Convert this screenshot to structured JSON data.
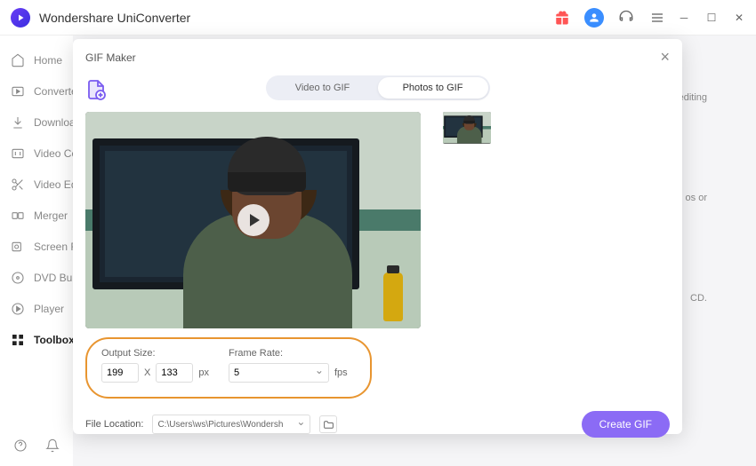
{
  "app": {
    "title": "Wondershare UniConverter"
  },
  "sidebar": {
    "items": [
      {
        "label": "Home"
      },
      {
        "label": "Converter"
      },
      {
        "label": "Downloader"
      },
      {
        "label": "Video Compressor"
      },
      {
        "label": "Video Editor"
      },
      {
        "label": "Merger"
      },
      {
        "label": "Screen Recorder"
      },
      {
        "label": "DVD Burner"
      },
      {
        "label": "Player"
      },
      {
        "label": "Toolbox"
      }
    ]
  },
  "modal": {
    "title": "GIF Maker",
    "tabs": {
      "video": "Video to GIF",
      "photos": "Photos to GIF"
    },
    "settings": {
      "output_size_label": "Output Size:",
      "width": "199",
      "times": "X",
      "height": "133",
      "unit": "px",
      "frame_rate_label": "Frame Rate:",
      "fps_value": "5",
      "fps_unit": "fps"
    },
    "footer": {
      "location_label": "File Location:",
      "location_value": "C:\\Users\\ws\\Pictures\\Wondersh",
      "create_label": "Create GIF"
    }
  },
  "bg": {
    "text1": "editing",
    "text2": "os or",
    "text3": "CD."
  }
}
